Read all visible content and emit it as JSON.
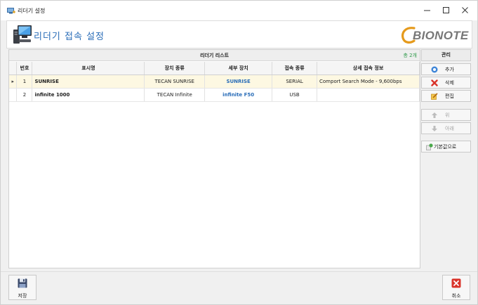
{
  "window": {
    "title": "리더기 설정",
    "icons": {
      "app": "device-icon",
      "minimize": "minimize-icon",
      "maximize": "maximize-icon",
      "close": "close-icon"
    }
  },
  "header": {
    "title": "리더기 접속 설정",
    "logo": "BIONOTE",
    "icon": "computer-icon"
  },
  "list": {
    "caption": "리더기 리스트",
    "count": "총 2개",
    "columns": [
      "번호",
      "표시명",
      "장치 종류",
      "세부 장치",
      "접속 종류",
      "상세 접속 정보"
    ],
    "rows": [
      {
        "indicator": "▸",
        "no": "1",
        "name": "SUNRISE",
        "type": "TECAN SUNRISE",
        "sub": "SUNRISE",
        "conn": "SERIAL",
        "detail": "Comport Search Mode - 9,600bps"
      },
      {
        "indicator": "",
        "no": "2",
        "name": "infinite 1000",
        "type": "TECAN Infinite",
        "sub": "infinite F50",
        "conn": "USB",
        "detail": ""
      }
    ]
  },
  "side": {
    "title": "관리",
    "add": "추가",
    "delete": "삭제",
    "edit": "편집",
    "up": "위",
    "down": "아래",
    "default": "기본값으로"
  },
  "footer": {
    "save": "저장",
    "cancel": "취소"
  },
  "colors": {
    "accent": "#2a6db8",
    "selected_row": "#fdf8e2",
    "count": "#2e9a4a",
    "cancel_red": "#d9342b"
  }
}
